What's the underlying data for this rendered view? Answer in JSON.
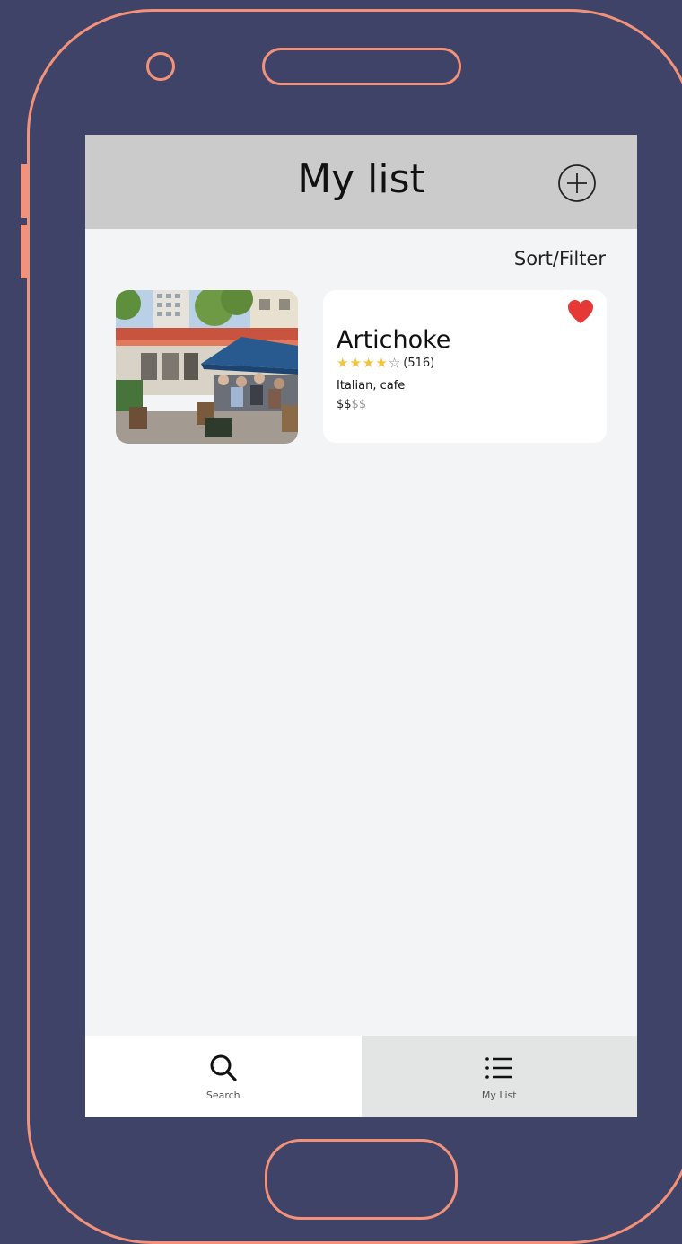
{
  "header": {
    "title": "My list",
    "add_icon": "plus-circle-icon"
  },
  "toolbar": {
    "sort_filter_label": "Sort/Filter"
  },
  "restaurant": {
    "name": "Artichoke",
    "rating_stars": 4,
    "rating_max": 5,
    "review_count": "(516)",
    "cuisine": "Italian, cafe",
    "price_active": "$$",
    "price_inactive": "$$",
    "favorite": true,
    "favorite_icon": "heart-icon",
    "favorite_color": "#e53935"
  },
  "tabbar": {
    "items": [
      {
        "label": "Search",
        "icon": "search-icon",
        "active": false
      },
      {
        "label": "My List",
        "icon": "list-icon",
        "active": true
      }
    ]
  },
  "colors": {
    "background": "#404368",
    "frame": "#f2927a",
    "header_bg": "#cbcbcb",
    "screen_bg": "#f3f4f6",
    "star": "#f3c33a"
  }
}
